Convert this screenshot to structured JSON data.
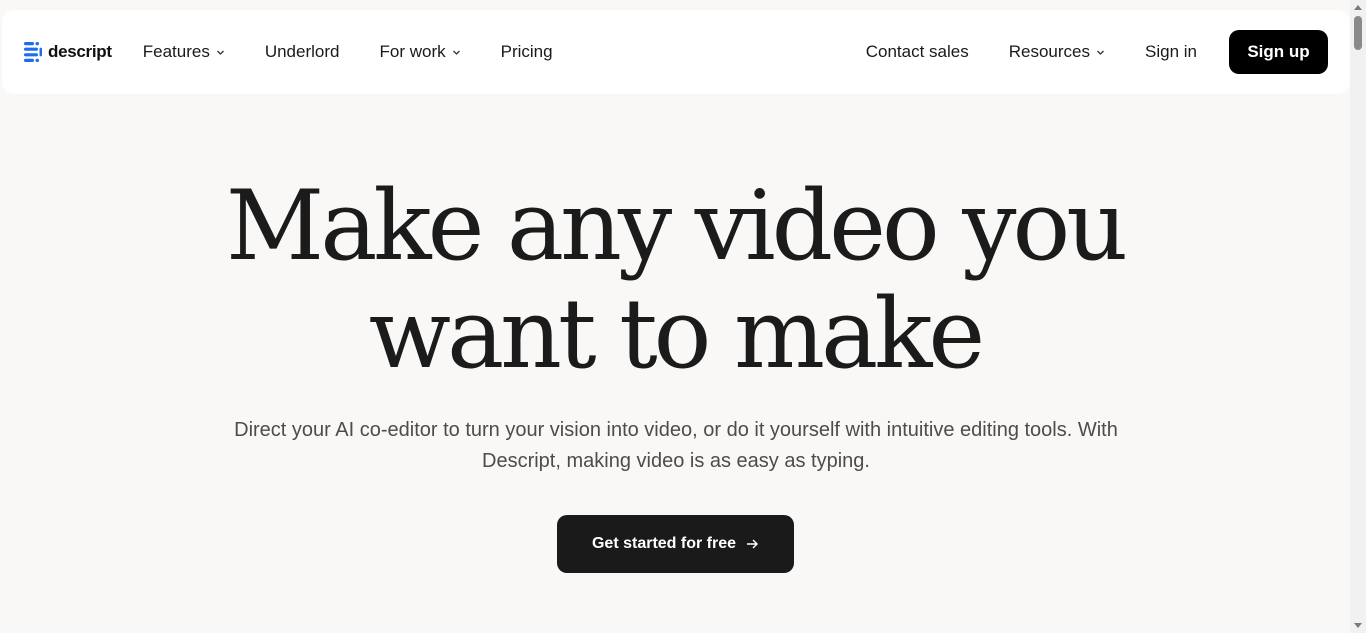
{
  "brand": {
    "name": "descript",
    "logo_icon": "descript-logo-icon",
    "accent": "#1e6cf0"
  },
  "nav": {
    "left": [
      {
        "label": "Features",
        "has_dropdown": true
      },
      {
        "label": "Underlord",
        "has_dropdown": false
      },
      {
        "label": "For work",
        "has_dropdown": true
      },
      {
        "label": "Pricing",
        "has_dropdown": false
      }
    ],
    "right": {
      "contact_sales": "Contact sales",
      "resources": "Resources",
      "sign_in": "Sign in",
      "sign_up": "Sign up"
    }
  },
  "hero": {
    "title_line1": "Make any video you",
    "title_line2": "want to make",
    "subtitle": "Direct your AI co-editor to turn your vision into video, or do it yourself with intuitive editing tools. With Descript, making video is as easy as typing.",
    "cta_label": "Get started for free",
    "cta_icon": "arrow-right-icon"
  },
  "colors": {
    "background": "#f9f8f6",
    "header_bg": "#ffffff",
    "button_dark": "#000000",
    "text": "#1a1a1a"
  }
}
